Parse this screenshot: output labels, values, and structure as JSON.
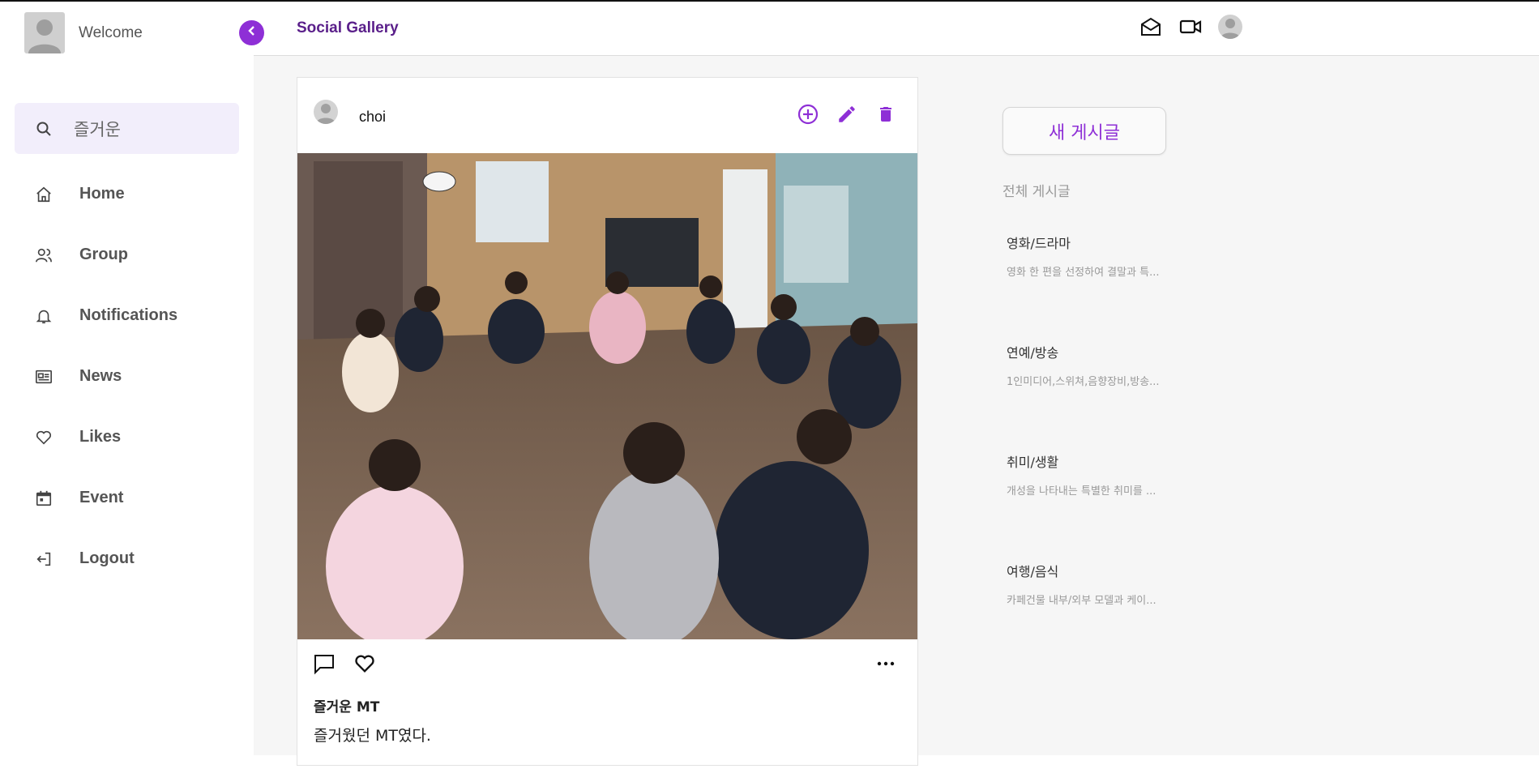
{
  "sidebar": {
    "welcome": "Welcome",
    "search": {
      "value": "즐거운",
      "placeholder": ""
    },
    "items": [
      {
        "label": "Home",
        "icon": "home-icon"
      },
      {
        "label": "Group",
        "icon": "group-icon"
      },
      {
        "label": "Notifications",
        "icon": "bell-icon"
      },
      {
        "label": "News",
        "icon": "newspaper-icon"
      },
      {
        "label": "Likes",
        "icon": "heart-icon"
      },
      {
        "label": "Event",
        "icon": "calendar-icon"
      },
      {
        "label": "Logout",
        "icon": "logout-icon"
      }
    ]
  },
  "header": {
    "brand": "Social Gallery",
    "icons": [
      "mail-icon",
      "video-icon",
      "avatar"
    ]
  },
  "post": {
    "user": "choi",
    "title": "즐거운 MT",
    "body": "즐거웠던 MT였다.",
    "actions": [
      "add-circle-icon",
      "edit-icon",
      "trash-icon"
    ]
  },
  "right_panel": {
    "new_post_label": "새 게시글",
    "all_posts_label": "전체 게시글",
    "categories": [
      {
        "title": "영화/드라마",
        "desc": "영화 한 편을 선정하여 결말과 특..."
      },
      {
        "title": "연예/방송",
        "desc": "1인미디어,스위쳐,음향장비,방송..."
      },
      {
        "title": "취미/생활",
        "desc": "개성을 나타내는 특별한 취미를 ..."
      },
      {
        "title": "여행/음식",
        "desc": "카페건물 내부/외부 모델과 케이..."
      }
    ]
  },
  "colors": {
    "accent": "#8e2fd6",
    "brand": "#5a1f8a",
    "search_bg": "#f2eefb"
  }
}
